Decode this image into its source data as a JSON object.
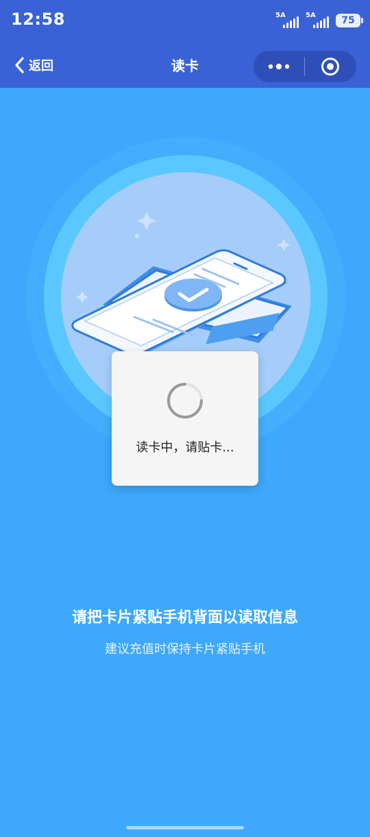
{
  "status_bar": {
    "time": "12:58",
    "signal_1_label": "5A",
    "signal_2_label": "5A",
    "battery": "75"
  },
  "nav": {
    "back_label": "返回",
    "title": "读卡",
    "more_icon": "more-dots-icon",
    "close_icon": "target-circle-icon"
  },
  "illustration": {
    "icon": "phone-card-nfc-illustration"
  },
  "loading": {
    "text": "读卡中，请贴卡..."
  },
  "instructions": {
    "headline": "请把卡片紧贴手机背面以读取信息",
    "subline": "建议充值时保持卡片紧贴手机"
  },
  "colors": {
    "background": "#3ea8fd",
    "header": "#3a62d6",
    "capsule": "#2f4fb8",
    "toast": "#f5f5f5"
  }
}
